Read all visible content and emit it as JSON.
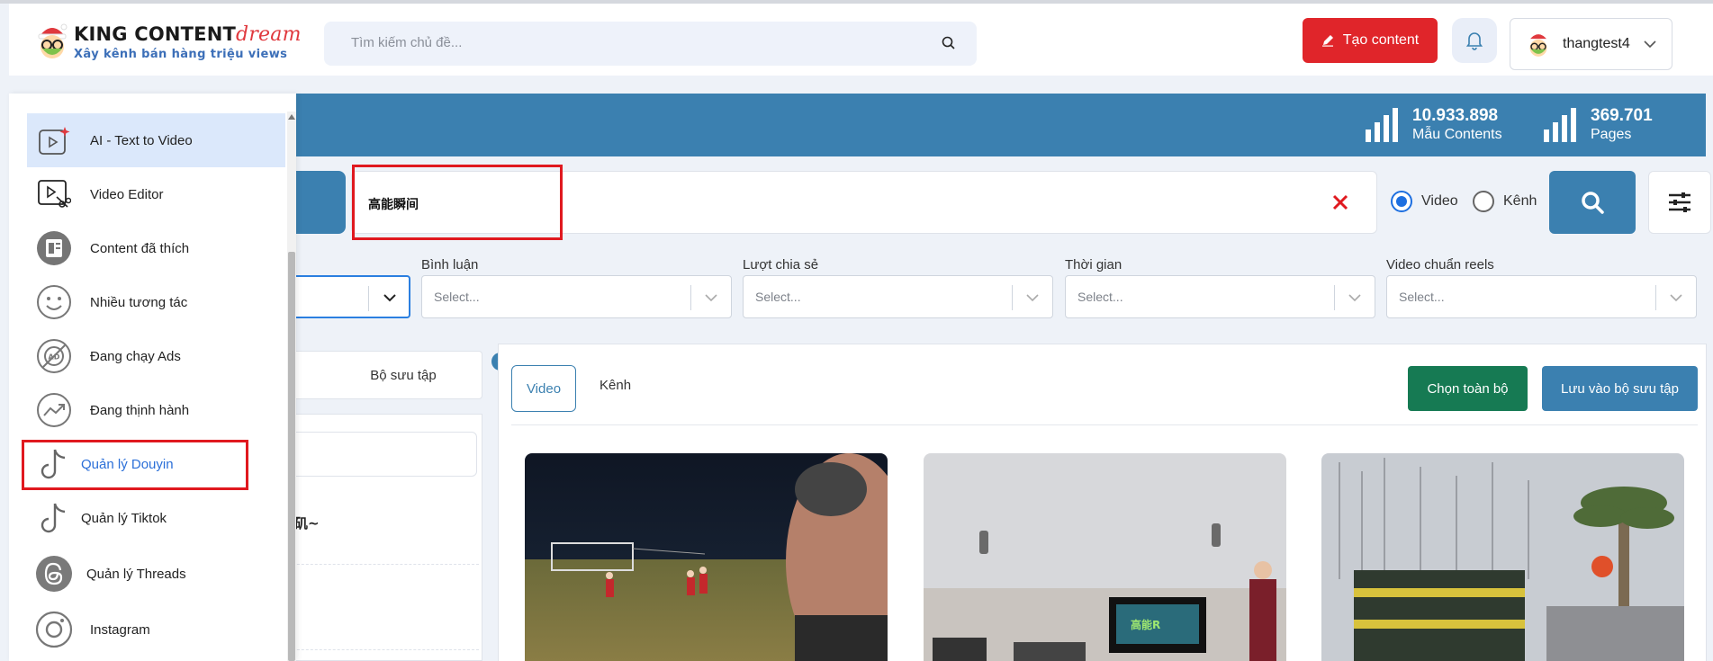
{
  "header": {
    "logo_main": "KING CONTENT",
    "logo_accent": "dream",
    "logo_tagline": "Xây kênh bán hàng triệu views",
    "search_placeholder": "Tìm kiếm chủ đề...",
    "create_label": "Tạo content",
    "username": "thangtest4"
  },
  "stats": [
    {
      "value": "10.933.898",
      "label": "Mẫu Contents"
    },
    {
      "value": "369.701",
      "label": "Pages"
    }
  ],
  "search": {
    "query": "高能瞬间",
    "radio_video": "Video",
    "radio_channel": "Kênh",
    "selected": "Video"
  },
  "filters": [
    {
      "label": "Bình luận",
      "placeholder": "Select..."
    },
    {
      "label": "Lượt chia sẻ",
      "placeholder": "Select..."
    },
    {
      "label": "Thời gian",
      "placeholder": "Select..."
    },
    {
      "label": "Video chuẩn reels",
      "placeholder": "Select..."
    }
  ],
  "left_panel": {
    "tab_label": "Bộ sưu tập",
    "partial_text": "矶~"
  },
  "content": {
    "tab_video": "Video",
    "tab_channel": "Kênh",
    "select_all": "Chọn toàn bộ",
    "save_collection": "Lưu vào bộ sưu tập"
  },
  "sidebar": {
    "items": [
      {
        "label": "AI - Text to Video",
        "icon": "ai-video-icon",
        "active": true
      },
      {
        "label": "Video Editor",
        "icon": "video-editor-icon"
      },
      {
        "label": "Content đã thích",
        "icon": "liked-content-icon"
      },
      {
        "label": "Nhiều tương tác",
        "icon": "smile-icon"
      },
      {
        "label": "Đang chạy Ads",
        "icon": "ads-icon"
      },
      {
        "label": "Đang thịnh hành",
        "icon": "trending-icon"
      },
      {
        "label": "Quản lý Douyin",
        "icon": "douyin-icon"
      },
      {
        "label": "Quản lý Tiktok",
        "icon": "tiktok-icon"
      },
      {
        "label": "Quản lý Threads",
        "icon": "threads-icon"
      },
      {
        "label": "Instagram",
        "icon": "instagram-icon"
      }
    ]
  },
  "colors": {
    "brand_blue": "#3b80b0",
    "create_red": "#e0252a",
    "select_all_green": "#167a53",
    "highlight_red": "#e0191f",
    "active_item_bg": "#dbe8fb"
  }
}
